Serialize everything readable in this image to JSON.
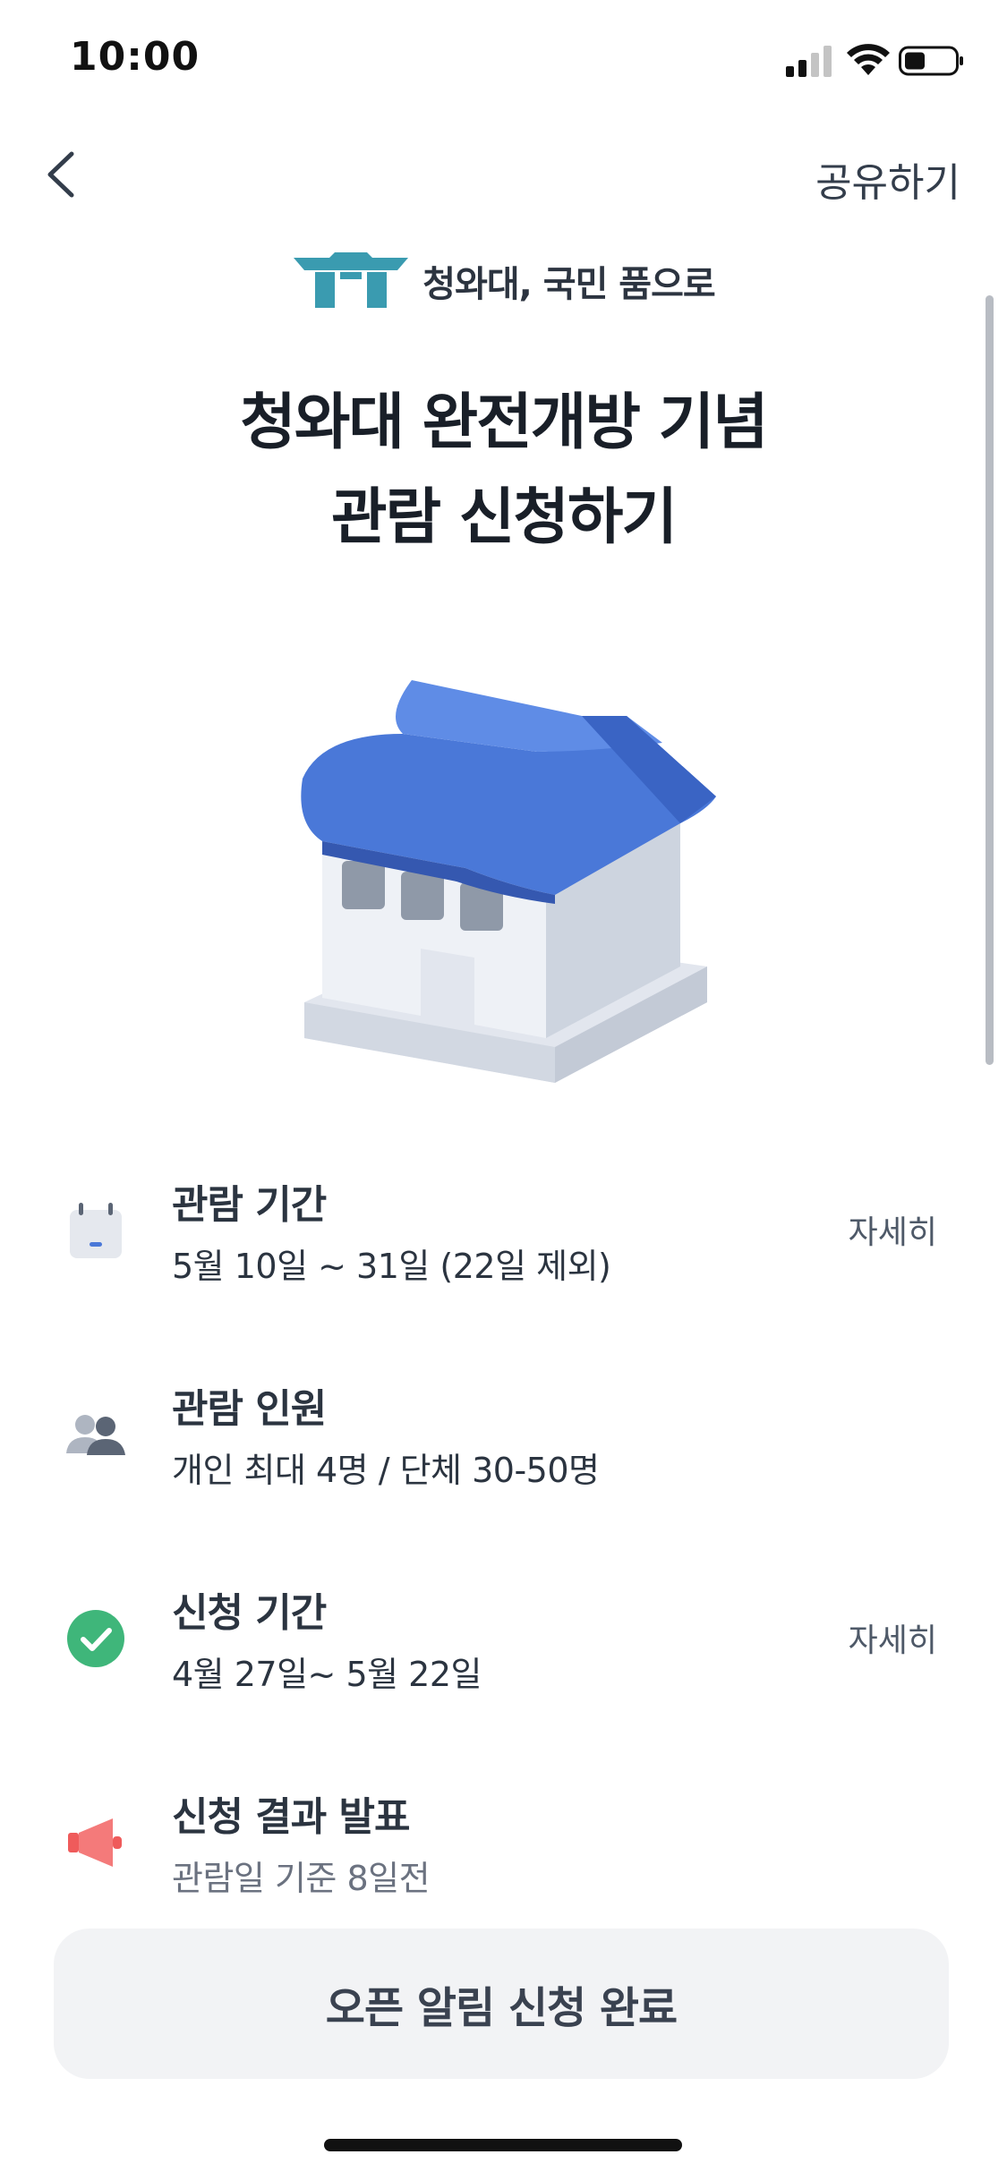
{
  "status_bar": {
    "time": "10:00"
  },
  "nav": {
    "share_label": "공유하기"
  },
  "brand": {
    "logo_text": "청와대, 국민 품으로"
  },
  "headline": {
    "line1": "청와대 완전개방 기념",
    "line2": "관람 신청하기"
  },
  "info_items": [
    {
      "icon": "calendar-icon",
      "title": "관람 기간",
      "subtitle": "5월 10일 ~ 31일 (22일 제외)",
      "detail": "자세히"
    },
    {
      "icon": "people-icon",
      "title": "관람 인원",
      "subtitle": "개인 최대 4명 / 단체 30-50명",
      "detail": ""
    },
    {
      "icon": "check-icon",
      "title": "신청 기간",
      "subtitle": "4월 27일~ 5월 22일",
      "detail": "자세히"
    },
    {
      "icon": "megaphone-icon",
      "title": "신청 결과 발표",
      "subtitle": "관람일 기준 8일전",
      "detail": ""
    }
  ],
  "cta": {
    "label": "오픈 알림 신청 완료"
  },
  "colors": {
    "accent_blue": "#4a78d8",
    "check_green": "#3fb67a",
    "megaphone_red": "#ef5b5b",
    "logo_teal": "#3a9bb0"
  }
}
